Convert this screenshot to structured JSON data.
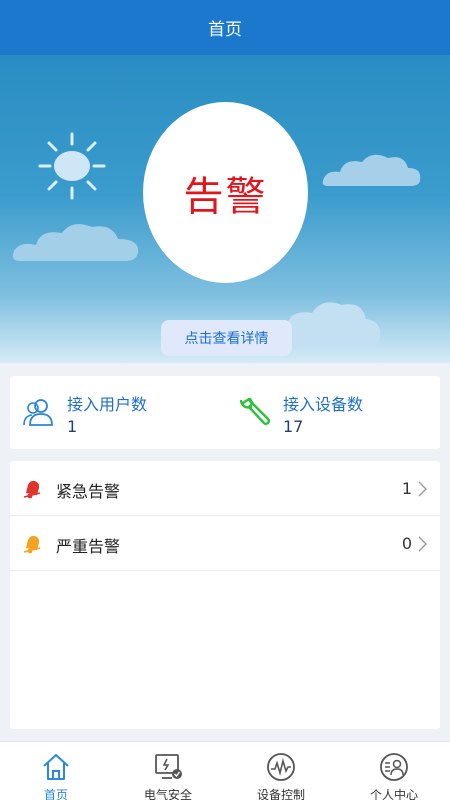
{
  "header": {
    "title": "首页"
  },
  "status": {
    "text": "告警",
    "detail_button": "点击查看详情"
  },
  "stats": [
    {
      "label": "接入用户数",
      "value": "1",
      "icon": "users-icon"
    },
    {
      "label": "接入设备数",
      "value": "17",
      "icon": "wrench-icon"
    }
  ],
  "alerts": [
    {
      "label": "紧急告警",
      "count": "1",
      "icon": "bell-red-icon"
    },
    {
      "label": "严重告警",
      "count": "0",
      "icon": "bell-orange-icon"
    }
  ],
  "nav": [
    {
      "label": "首页",
      "icon": "home-icon",
      "active": true
    },
    {
      "label": "电气安全",
      "icon": "electrical-safety-icon",
      "active": false
    },
    {
      "label": "设备控制",
      "icon": "device-control-icon",
      "active": false
    },
    {
      "label": "个人中心",
      "icon": "profile-icon",
      "active": false
    }
  ],
  "colors": {
    "header": "#1c78cc",
    "alarm_text": "#e3141a",
    "accent": "#1e6fcf",
    "active_nav": "#2a8ad8"
  }
}
